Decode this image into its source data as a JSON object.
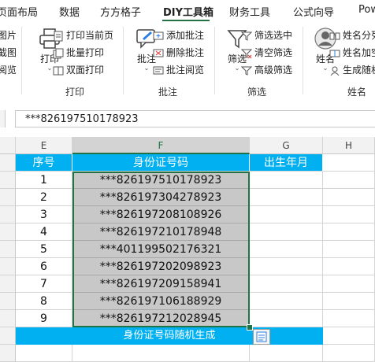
{
  "tabs": [
    "页面布局",
    "数据",
    "方方格子",
    "DIY工具箱",
    "财务工具",
    "公式向导",
    "Pow"
  ],
  "ribbon": {
    "left_partial": [
      "图片",
      "截图",
      "阅览"
    ],
    "print_group": {
      "label": "打印",
      "big_button": "打印",
      "items": [
        "打印当前页",
        "批量打印",
        "双面打印"
      ]
    },
    "comment_group": {
      "label": "批注",
      "big_button": "批注",
      "items": [
        "添加批注",
        "删除批注",
        "批注阅览"
      ]
    },
    "filter_group": {
      "label": "筛选",
      "big_button": "筛选",
      "items": [
        "筛选选中",
        "清空筛选",
        "高级筛选"
      ]
    },
    "name_group": {
      "label": "姓名",
      "big_button": "姓名",
      "items": [
        "姓名分列",
        "姓名加空",
        "生成随机"
      ]
    }
  },
  "formula_bar": {
    "value": "***826197510178923"
  },
  "columns": [
    "E",
    "F",
    "G",
    "H"
  ],
  "table": {
    "headers": [
      "序号",
      "身份证号码",
      "出生年月"
    ],
    "rows": [
      {
        "no": "1",
        "id": "***826197510178923"
      },
      {
        "no": "2",
        "id": "***826197304278923"
      },
      {
        "no": "3",
        "id": "***826197208108926"
      },
      {
        "no": "4",
        "id": "***826197210178948"
      },
      {
        "no": "5",
        "id": "***401199502176321"
      },
      {
        "no": "6",
        "id": "***826197202098923"
      },
      {
        "no": "7",
        "id": "***826197209158941"
      },
      {
        "no": "8",
        "id": "***826197106188929"
      },
      {
        "no": "9",
        "id": "***826197212028945"
      }
    ],
    "footer": "身份证号码随机生成"
  },
  "colors": {
    "accent": "#217346",
    "header_blue": "#00b0f0",
    "selection_fill": "#c8c8c8"
  }
}
